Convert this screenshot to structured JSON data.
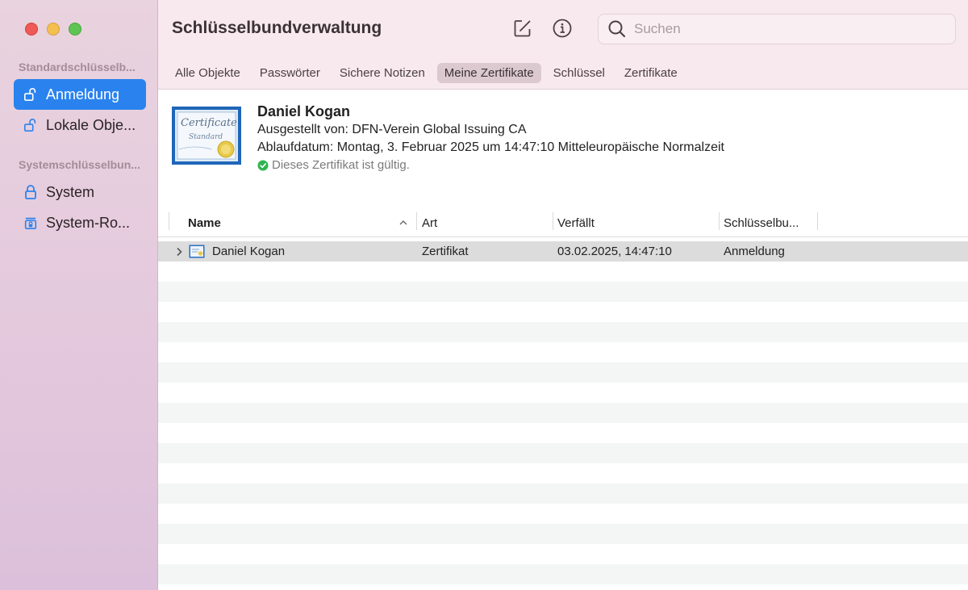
{
  "window": {
    "title": "Schlüsselbundverwaltung"
  },
  "sidebar": {
    "sections": [
      {
        "header": "Standardschlüsselb...",
        "items": [
          {
            "label": "Anmeldung",
            "icon": "unlocked-padlock-icon",
            "active": true
          },
          {
            "label": "Lokale Obje...",
            "icon": "unlocked-padlock-icon",
            "active": false
          }
        ]
      },
      {
        "header": "Systemschlüsselbun...",
        "items": [
          {
            "label": "System",
            "icon": "locked-padlock-icon",
            "active": false
          },
          {
            "label": "System-Ro...",
            "icon": "locked-cabinet-icon",
            "active": false
          }
        ]
      }
    ]
  },
  "toolbar": {
    "edit_icon": "compose-icon",
    "info_icon": "info-icon",
    "search_placeholder": "Suchen"
  },
  "tabs": [
    {
      "label": "Alle Objekte",
      "active": false
    },
    {
      "label": "Passwörter",
      "active": false
    },
    {
      "label": "Sichere Notizen",
      "active": false
    },
    {
      "label": "Meine Zertifikate",
      "active": true
    },
    {
      "label": "Schlüssel",
      "active": false
    },
    {
      "label": "Zertifikate",
      "active": false
    }
  ],
  "detail": {
    "thumbnail_text_1": "Certificate",
    "thumbnail_text_2": "Standard",
    "name": "Daniel Kogan",
    "issuer": "Ausgestellt von: DFN-Verein Global Issuing CA",
    "expiry": "Ablaufdatum: Montag, 3. Februar 2025 um 14:47:10 Mitteleuropäische Normalzeit",
    "status": "Dieses Zertifikat ist gültig.",
    "status_color": "#2fb550"
  },
  "table": {
    "columns": [
      "Name",
      "Art",
      "Verfällt",
      "Schlüsselbu..."
    ],
    "sort_indicator": "^",
    "rows": [
      {
        "name": "Daniel Kogan",
        "type": "Zertifikat",
        "expires": "03.02.2025, 14:47:10",
        "keychain": "Anmeldung",
        "selected": true
      }
    ]
  },
  "colors": {
    "accent": "#2a82ee",
    "sidebar": "#e6cfdd",
    "toolbar": "#f8e9ee"
  }
}
